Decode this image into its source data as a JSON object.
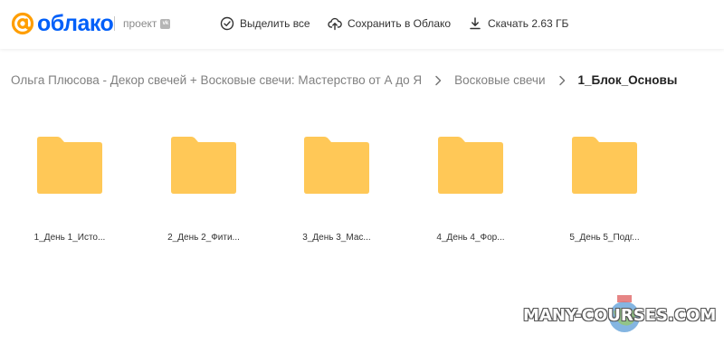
{
  "header": {
    "logo_text": "облако",
    "project_label": "проект",
    "vk_badge": "vk",
    "actions": {
      "select_all": "Выделить все",
      "save_to_cloud": "Сохранить в Облако",
      "download": "Скачать 2.63 ГБ"
    }
  },
  "breadcrumb": [
    "Ольга Плюсова - Декор свечей + Восковые свечи: Мастерство от А до Я",
    "Восковые свечи",
    "1_Блок_Основы"
  ],
  "folders": [
    "1_День 1_Исто...",
    "2_День 2_Фити...",
    "3_День 3_Мас...",
    "4_День 4_Фор...",
    "5_День 5_Подг..."
  ],
  "watermark": "MANY-COURSES.COM",
  "colors": {
    "brand_orange": "#ff9e00",
    "brand_blue": "#005ff9",
    "folder_yellow": "#ffc857"
  }
}
